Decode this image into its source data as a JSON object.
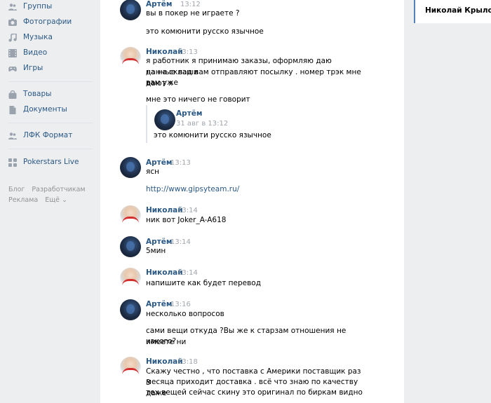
{
  "sidebar": {
    "items": [
      {
        "label": "Группы",
        "icon": "groups-icon"
      },
      {
        "label": "Фотографии",
        "icon": "photos-icon"
      },
      {
        "label": "Музыка",
        "icon": "music-icon"
      },
      {
        "label": "Видео",
        "icon": "video-icon"
      },
      {
        "label": "Игры",
        "icon": "games-icon"
      },
      {
        "label": "Товары",
        "icon": "goods-icon"
      },
      {
        "label": "Документы",
        "icon": "documents-icon"
      },
      {
        "label": "ЛФК Формат",
        "icon": "community-icon"
      },
      {
        "label": "Pokerstars Live",
        "icon": "app-icon"
      }
    ],
    "footer": {
      "blog": "Блог",
      "developers": "Разработчикам",
      "ads": "Реклама",
      "more": "Ещё ⌄"
    }
  },
  "chat": {
    "messages": [
      {
        "author": "Артём",
        "time": "13:12",
        "avatar": "artem",
        "lines": [
          "вы в покер не играете ?",
          "",
          "это комюнити русско язычное"
        ]
      },
      {
        "author": "Николай",
        "time": "13:13",
        "avatar": "nikolai",
        "lines": [
          "я работник я принимаю заказы, оформляю даю данные ваши",
          "на на склад вам отправляют посылку . номер трэк мне дают я",
          "вам уже",
          "",
          "мне это ничего не говорит"
        ]
      },
      {
        "author": "Артём",
        "time": "13:13",
        "avatar": "artem",
        "lines": [
          "ясн"
        ],
        "link": "http://www.gipsyteam.ru/"
      },
      {
        "author": "Николай",
        "time": "13:14",
        "avatar": "nikolai",
        "lines": [
          "ник вот Joker_A-A618"
        ]
      },
      {
        "author": "Артём",
        "time": "13:14",
        "avatar": "artem",
        "lines": [
          "5мин"
        ]
      },
      {
        "author": "Николай",
        "time": "13:14",
        "avatar": "nikolai",
        "lines": [
          "напишите как будет перевод"
        ]
      },
      {
        "author": "Артём",
        "time": "13:16",
        "avatar": "artem",
        "lines": [
          "несколько вопросов",
          "",
          "сами вещи откуда ?Вы же к старзам отношения не имеете ни",
          "какого?"
        ]
      },
      {
        "author": "Николай",
        "time": "13:18",
        "avatar": "nikolai",
        "lines": [
          "Скажу честно , что поставка с Америки поставщик раз 3",
          "месяца приходит доставка . всё что знаю по качеству даже",
          "тех вещей сейчас скину это оригинал по биркам видно"
        ]
      }
    ],
    "forwarded": {
      "author": "Артём",
      "date": "31 авг в 13:12",
      "text": "это комюнити русско язычное",
      "avatar": "artem"
    }
  },
  "right_panel": {
    "active_dialog": "Николай Крылов"
  },
  "colors": {
    "background": "#edeef0",
    "link": "#2a5885",
    "time": "#a0a6ad",
    "accent": "#5181b8"
  }
}
